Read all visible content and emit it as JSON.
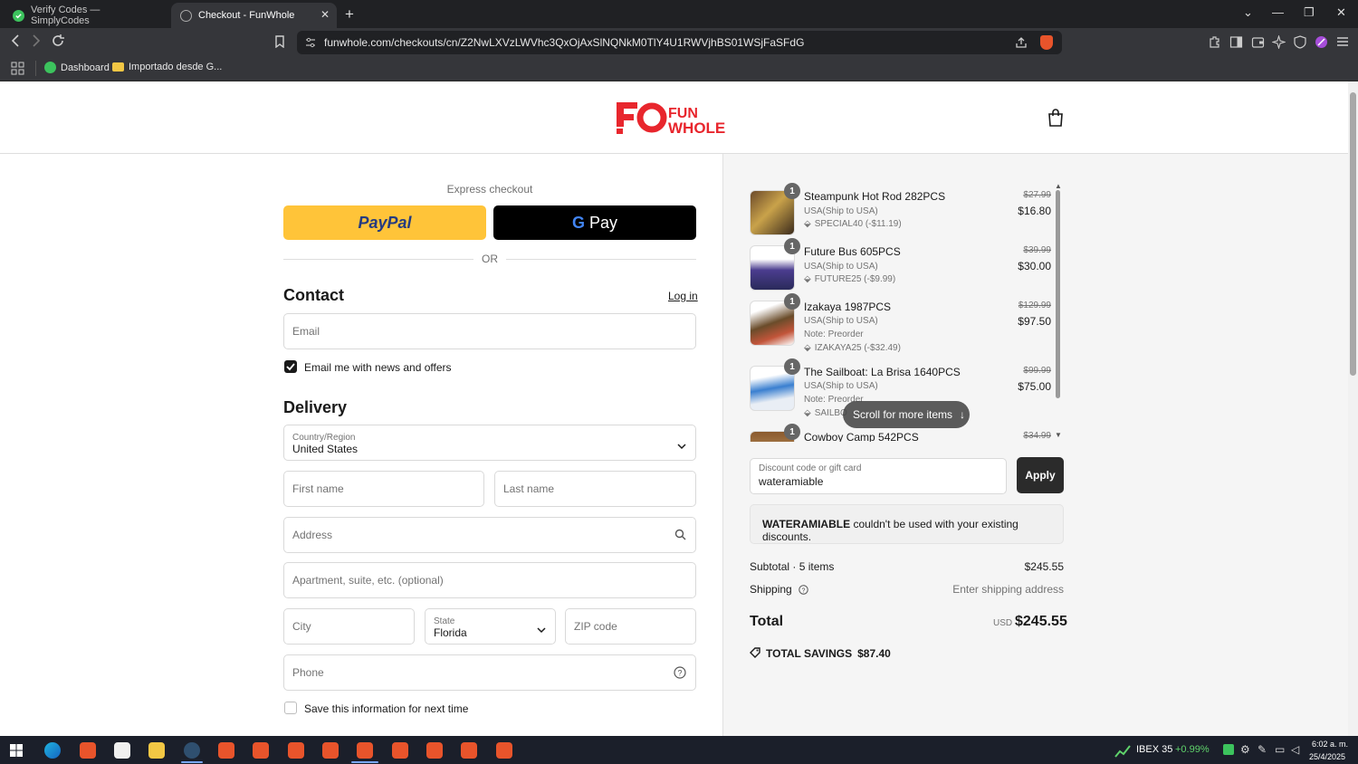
{
  "browser": {
    "tabs": [
      {
        "title": "Verify Codes — SimplyCodes",
        "active": false
      },
      {
        "title": "Checkout - FunWhole",
        "active": true
      }
    ],
    "url": "funwhole.com/checkouts/cn/Z2NwLXVzLWVhc3QxOjAxSlNQNkM0TlY4U1RWVjhBS01WSjFaSFdG",
    "bookmarks": [
      {
        "label": "Dashboard",
        "icon": "green-check-icon"
      },
      {
        "label": "Importado desde G...",
        "icon": "folder-icon"
      }
    ]
  },
  "site": {
    "logo_text": "FUN WHOLE"
  },
  "express": {
    "label": "Express checkout",
    "paypal_label": "PayPal",
    "gpay_label": "Pay",
    "or_label": "OR"
  },
  "contact": {
    "title": "Contact",
    "login_label": "Log in",
    "email_placeholder": "Email",
    "newsletter_label": "Email me with news and offers",
    "newsletter_checked": true
  },
  "delivery": {
    "title": "Delivery",
    "country_label": "Country/Region",
    "country_value": "United States",
    "first_name_placeholder": "First name",
    "last_name_placeholder": "Last name",
    "address_placeholder": "Address",
    "apartment_placeholder": "Apartment, suite, etc. (optional)",
    "city_placeholder": "City",
    "state_label": "State",
    "state_value": "Florida",
    "zip_placeholder": "ZIP code",
    "phone_placeholder": "Phone",
    "save_info_label": "Save this information for next time",
    "save_info_checked": false
  },
  "order": {
    "items": [
      {
        "qty": "1",
        "name": "Steampunk Hot Rod 282PCS",
        "ship": "USA(Ship to USA)",
        "note": "",
        "discount": "SPECIAL40 (-$11.19)",
        "old_price": "$27.99",
        "price": "$16.80"
      },
      {
        "qty": "1",
        "name": "Future Bus 605PCS",
        "ship": "USA(Ship to USA)",
        "note": "",
        "discount": "FUTURE25 (-$9.99)",
        "old_price": "$39.99",
        "price": "$30.00"
      },
      {
        "qty": "1",
        "name": "Izakaya 1987PCS",
        "ship": "USA(Ship to USA)",
        "note": "Note: Preorder",
        "discount": "IZAKAYA25 (-$32.49)",
        "old_price": "$129.99",
        "price": "$97.50"
      },
      {
        "qty": "1",
        "name": "The Sailboat: La Brisa 1640PCS",
        "ship": "USA(Ship to USA)",
        "note": "Note: Preorder",
        "discount": "SAILBO",
        "old_price": "$99.99",
        "price": "$75.00"
      },
      {
        "qty": "1",
        "name": "Cowboy Camp 542PCS",
        "ship": "",
        "note": "",
        "discount": "",
        "old_price": "$34.99",
        "price": ""
      }
    ],
    "scroll_hint": "Scroll for more items",
    "discount_label": "Discount code or gift card",
    "discount_value": "wateramiable",
    "apply_label": "Apply",
    "error_code": "WATERAMIABLE",
    "error_text": " couldn't be used with your existing discounts.",
    "subtotal_label": "Subtotal · 5 items",
    "subtotal_value": "$245.55",
    "shipping_label": "Shipping",
    "shipping_value": "Enter shipping address",
    "total_label": "Total",
    "total_currency": "USD",
    "total_value": "$245.55",
    "savings_label": "TOTAL SAVINGS",
    "savings_value": "$87.40"
  },
  "taskbar": {
    "ticker_name": "IBEX 35",
    "ticker_change": "+0.99%",
    "time": "6:02 a. m.",
    "date": "25/4/2025"
  },
  "colors": {
    "paypal": "#ffc439",
    "brand_red": "#e8262d",
    "apply": "#2b2b2b"
  }
}
